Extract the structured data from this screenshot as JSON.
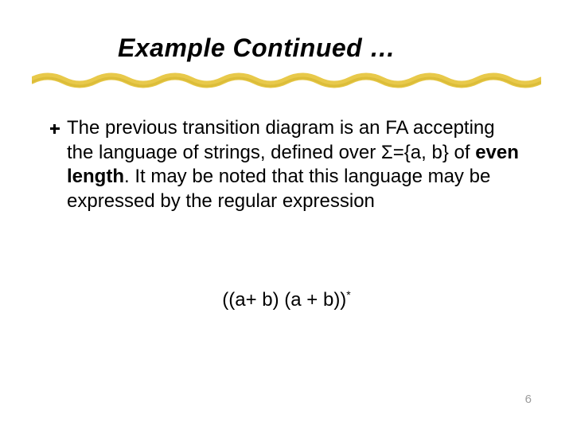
{
  "title": "Example Continued …",
  "bullet": {
    "pre": "The previous transition diagram is an FA accepting the language of strings, defined over Σ={a, b} of ",
    "bold": "even length",
    "post": ". It may be noted that this language may be expressed by the regular expression"
  },
  "expression": {
    "base": "((a+ b) (a + b))",
    "sup": "*"
  },
  "page_number": "6"
}
